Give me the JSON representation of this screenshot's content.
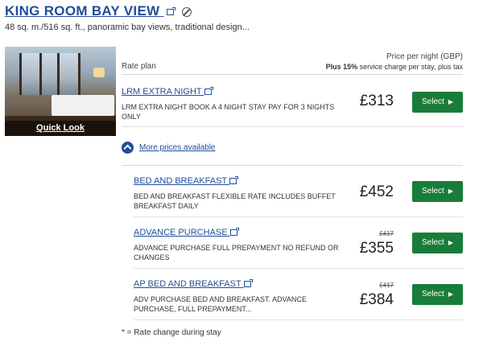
{
  "room": {
    "title": "KING ROOM BAY VIEW",
    "description": "48 sq. m./516 sq. ft., panoramic bay views, traditional design...",
    "quick_look": "Quick Look"
  },
  "header": {
    "rate_plan": "Rate plan",
    "price_label": "Price per night (GBP)",
    "service_bold": "Plus 15%",
    "service_rest": " service charge per stay, plus tax"
  },
  "rates": [
    {
      "name": "LRM EXTRA NIGHT",
      "desc": "LRM EXTRA NIGHT BOOK A 4 NIGHT STAY PAY FOR 3 NIGHTS ONLY",
      "old_price": "",
      "price": "£313",
      "button": "Select"
    },
    {
      "name": "BED AND BREAKFAST",
      "desc": "BED AND BREAKFAST FLEXIBLE RATE INCLUDES BUFFET BREAKFAST DAILY",
      "old_price": "",
      "price": "£452",
      "button": "Select"
    },
    {
      "name": "ADVANCE PURCHASE",
      "desc": "ADVANCE PURCHASE FULL PREPAYMENT NO REFUND OR CHANGES",
      "old_price": "£417",
      "price": "£355",
      "button": "Select"
    },
    {
      "name": "AP BED AND BREAKFAST",
      "desc": "ADV PURCHASE BED AND BREAKFAST. ADVANCE PURCHASE, FULL PREPAYMENT...",
      "old_price": "£417",
      "price": "£384",
      "button": "Select"
    }
  ],
  "more_prices": "More prices available",
  "footnote": "* = Rate change during stay",
  "icons": {
    "external": "external-link-icon",
    "no_smoking": "no-smoking-icon",
    "chevron": "chevron-up-circle-icon",
    "arrow": "arrow-right-icon"
  },
  "colors": {
    "link": "#1f4e9a",
    "button": "#1a7c3a"
  }
}
